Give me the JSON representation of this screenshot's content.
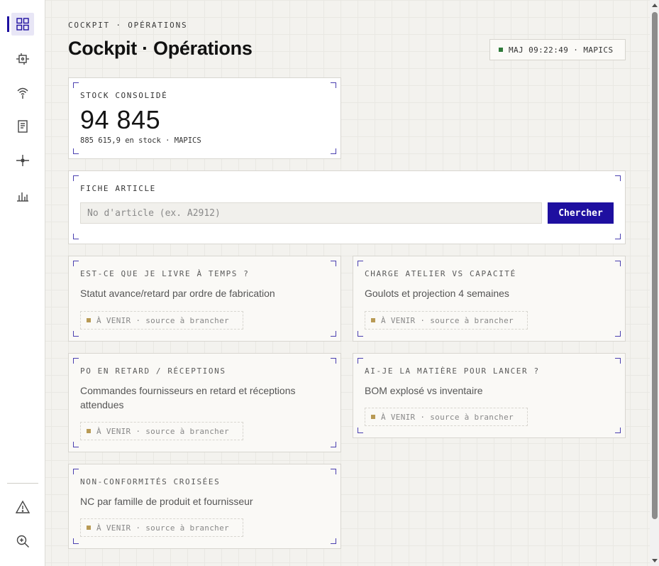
{
  "sidebar": {
    "items": [
      {
        "icon": "dashboard-grid-icon",
        "active": true
      },
      {
        "icon": "machine-icon"
      },
      {
        "icon": "signal-icon"
      },
      {
        "icon": "document-icon"
      },
      {
        "icon": "crosshair-icon"
      },
      {
        "icon": "bar-chart-icon"
      }
    ],
    "bottom_items": [
      {
        "icon": "warning-icon"
      },
      {
        "icon": "zoom-icon"
      }
    ]
  },
  "header": {
    "eyebrow": "COCKPIT · OPÉRATIONS",
    "title": "Cockpit · Opérations",
    "status": "MAJ 09:22:49 · MAPICS"
  },
  "stock": {
    "label": "STOCK CONSOLIDÉ",
    "value": "94 845",
    "sub": "885 615,9 en stock · MAPICS"
  },
  "article": {
    "label": "FICHE ARTICLE",
    "placeholder": "No d'article (ex. A2912)",
    "value": "",
    "button": "Chercher"
  },
  "cards": [
    {
      "title": "EST-CE QUE JE LIVRE À TEMPS ?",
      "desc": "Statut avance/retard par ordre de fabrication",
      "badge": "À VENIR · source à brancher"
    },
    {
      "title": "CHARGE ATELIER VS CAPACITÉ",
      "desc": "Goulots et projection 4 semaines",
      "badge": "À VENIR · source à brancher"
    },
    {
      "title": "PO EN RETARD / RÉCEPTIONS",
      "desc": "Commandes fournisseurs en retard et réceptions attendues",
      "badge": "À VENIR · source à brancher"
    },
    {
      "title": "AI-JE LA MATIÈRE POUR LANCER ?",
      "desc": "BOM explosé vs inventaire",
      "badge": "À VENIR · source à brancher"
    },
    {
      "title": "NON-CONFORMITÉS CROISÉES",
      "desc": "NC par famille de produit et fournisseur",
      "badge": "À VENIR · source à brancher"
    }
  ],
  "colors": {
    "accent": "#1e0fa0",
    "status_ok": "#2f7a3a",
    "pending": "#b89a55"
  }
}
